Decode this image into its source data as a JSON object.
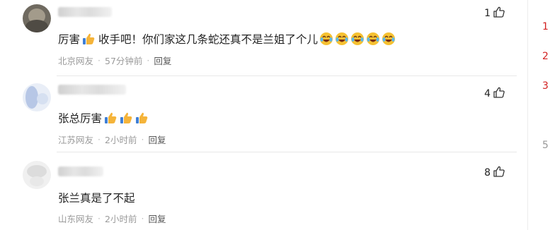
{
  "comments": [
    {
      "text": "厉害",
      "text_after": "收手吧！你们家这几条蛇还真不是兰姐了个儿",
      "location": "北京网友",
      "time": "57分钟前",
      "reply_label": "回复",
      "likes": "1"
    },
    {
      "text": "张总厉害",
      "location": "江苏网友",
      "time": "2小时前",
      "reply_label": "回复",
      "likes": "4"
    },
    {
      "text": "张兰真是了不起",
      "location": "山东网友",
      "time": "2小时前",
      "reply_label": "回复",
      "likes": "8"
    }
  ],
  "rank_numbers": [
    "1",
    "2",
    "3",
    "5"
  ],
  "colors": {
    "rank_red": "#d22222",
    "rank_gray": "#999999",
    "meta": "#9b9b9b"
  },
  "icons": {
    "like": "thumbs-up-outline-icon",
    "emoji_thumb": "thumbs-up-emoji",
    "emoji_laugh": "laughing-tears-emoji"
  }
}
